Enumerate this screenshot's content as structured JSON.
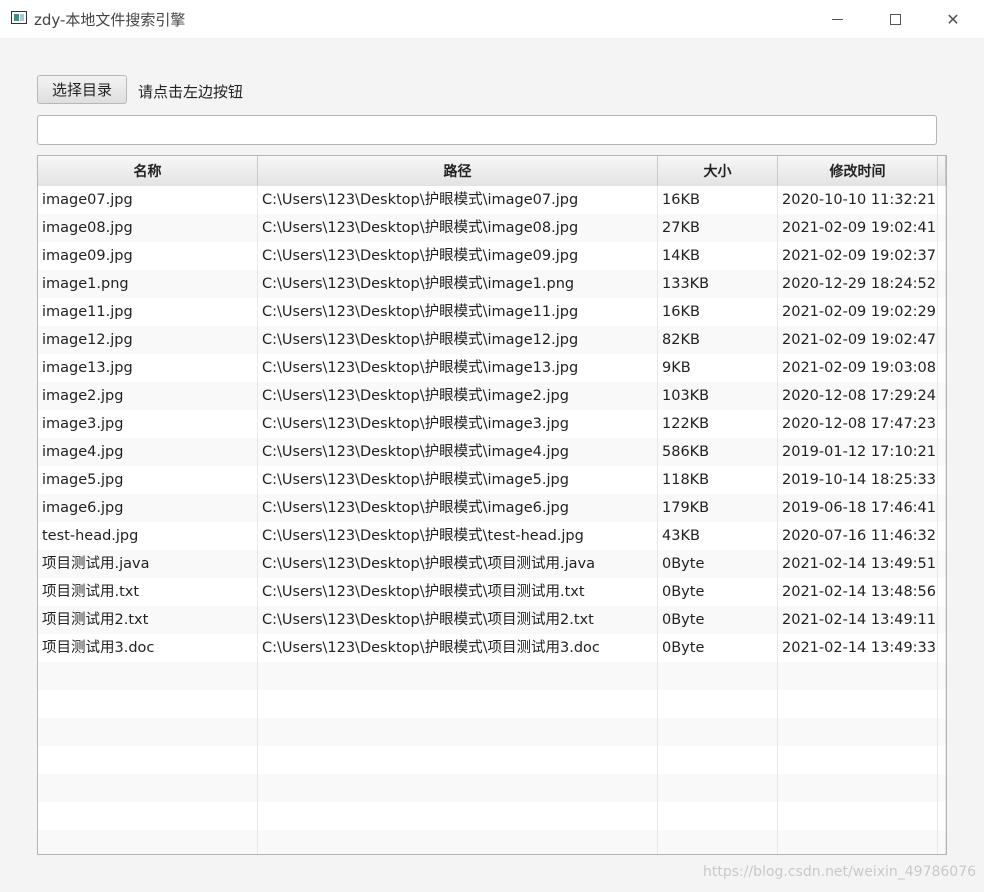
{
  "window": {
    "title": "zdy-本地文件搜索引擎",
    "icon": "app-window-icon",
    "controls": [
      "minimize-icon",
      "maximize-icon",
      "close-icon"
    ],
    "close_glyph": "✕"
  },
  "toolbar": {
    "choose_label": "选择目录",
    "hint": "请点击左边按钮"
  },
  "search": {
    "value": "",
    "placeholder": ""
  },
  "table": {
    "columns": [
      "名称",
      "路径",
      "大小",
      "修改时间"
    ],
    "rows": [
      [
        "image07.jpg",
        "C:\\Users\\123\\Desktop\\护眼模式\\image07.jpg",
        "16KB",
        "2020-10-10 11:32:21"
      ],
      [
        "image08.jpg",
        "C:\\Users\\123\\Desktop\\护眼模式\\image08.jpg",
        "27KB",
        "2021-02-09 19:02:41"
      ],
      [
        "image09.jpg",
        "C:\\Users\\123\\Desktop\\护眼模式\\image09.jpg",
        "14KB",
        "2021-02-09 19:02:37"
      ],
      [
        "image1.png",
        "C:\\Users\\123\\Desktop\\护眼模式\\image1.png",
        "133KB",
        "2020-12-29 18:24:52"
      ],
      [
        "image11.jpg",
        "C:\\Users\\123\\Desktop\\护眼模式\\image11.jpg",
        "16KB",
        "2021-02-09 19:02:29"
      ],
      [
        "image12.jpg",
        "C:\\Users\\123\\Desktop\\护眼模式\\image12.jpg",
        "82KB",
        "2021-02-09 19:02:47"
      ],
      [
        "image13.jpg",
        "C:\\Users\\123\\Desktop\\护眼模式\\image13.jpg",
        "9KB",
        "2021-02-09 19:03:08"
      ],
      [
        "image2.jpg",
        "C:\\Users\\123\\Desktop\\护眼模式\\image2.jpg",
        "103KB",
        "2020-12-08 17:29:24"
      ],
      [
        "image3.jpg",
        "C:\\Users\\123\\Desktop\\护眼模式\\image3.jpg",
        "122KB",
        "2020-12-08 17:47:23"
      ],
      [
        "image4.jpg",
        "C:\\Users\\123\\Desktop\\护眼模式\\image4.jpg",
        "586KB",
        "2019-01-12 17:10:21"
      ],
      [
        "image5.jpg",
        "C:\\Users\\123\\Desktop\\护眼模式\\image5.jpg",
        "118KB",
        "2019-10-14 18:25:33"
      ],
      [
        "image6.jpg",
        "C:\\Users\\123\\Desktop\\护眼模式\\image6.jpg",
        "179KB",
        "2019-06-18 17:46:41"
      ],
      [
        "test-head.jpg",
        "C:\\Users\\123\\Desktop\\护眼模式\\test-head.jpg",
        "43KB",
        "2020-07-16 11:46:32"
      ],
      [
        "项目测试用.java",
        "C:\\Users\\123\\Desktop\\护眼模式\\项目测试用.java",
        "0Byte",
        "2021-02-14 13:49:51"
      ],
      [
        "项目测试用.txt",
        "C:\\Users\\123\\Desktop\\护眼模式\\项目测试用.txt",
        "0Byte",
        "2021-02-14 13:48:56"
      ],
      [
        "项目测试用2.txt",
        "C:\\Users\\123\\Desktop\\护眼模式\\项目测试用2.txt",
        "0Byte",
        "2021-02-14 13:49:11"
      ],
      [
        "项目测试用3.doc",
        "C:\\Users\\123\\Desktop\\护眼模式\\项目测试用3.doc",
        "0Byte",
        "2021-02-14 13:49:33"
      ]
    ]
  },
  "watermark": "https://blog.csdn.net/weixin_49786076"
}
